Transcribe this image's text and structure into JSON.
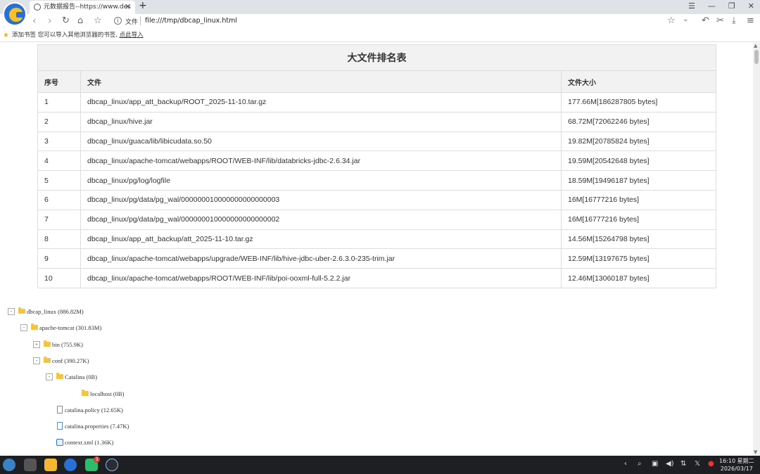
{
  "browser": {
    "tab_title": "元数据报告--https://www.des",
    "address_label": "文件",
    "url": "file:///tmp/dbcap_linux.html",
    "bookmark_bar_text": "添加书签  您可以导入其他浏览器的书签,",
    "bookmark_import_link": "点此导入"
  },
  "table": {
    "title": "大文件排名表",
    "headers": [
      "序号",
      "文件",
      "文件大小"
    ],
    "rows": [
      {
        "no": "1",
        "file": "dbcap_linux/app_att_backup/ROOT_2025-11-10.tar.gz",
        "size": "177.66M[186287805 bytes]"
      },
      {
        "no": "2",
        "file": "dbcap_linux/hive.jar",
        "size": "68.72M[72062246 bytes]"
      },
      {
        "no": "3",
        "file": "dbcap_linux/guaca/lib/libicudata.so.50",
        "size": "19.82M[20785824 bytes]"
      },
      {
        "no": "4",
        "file": "dbcap_linux/apache-tomcat/webapps/ROOT/WEB-INF/lib/databricks-jdbc-2.6.34.jar",
        "size": "19.59M[20542648 bytes]"
      },
      {
        "no": "5",
        "file": "dbcap_linux/pg/log/logfile",
        "size": "18.59M[19496187 bytes]"
      },
      {
        "no": "6",
        "file": "dbcap_linux/pg/data/pg_wal/000000010000000000000003",
        "size": "16M[16777216 bytes]"
      },
      {
        "no": "7",
        "file": "dbcap_linux/pg/data/pg_wal/000000010000000000000002",
        "size": "16M[16777216 bytes]"
      },
      {
        "no": "8",
        "file": "dbcap_linux/app_att_backup/att_2025-11-10.tar.gz",
        "size": "14.56M[15264798 bytes]"
      },
      {
        "no": "9",
        "file": "dbcap_linux/apache-tomcat/webapps/upgrade/WEB-INF/lib/hive-jdbc-uber-2.6.3.0-235-trim.jar",
        "size": "12.59M[13197675 bytes]"
      },
      {
        "no": "10",
        "file": "dbcap_linux/apache-tomcat/webapps/ROOT/WEB-INF/lib/poi-ooxml-full-5.2.2.jar",
        "size": "12.46M[13060187 bytes]"
      }
    ]
  },
  "tree": [
    {
      "label": "dbcap_linux (886.82M)",
      "type": "folder",
      "toggle": "-",
      "depth": 0
    },
    {
      "label": "apache-tomcat (301.83M)",
      "type": "folder",
      "toggle": "-",
      "depth": 1
    },
    {
      "label": "bin (755.9K)",
      "type": "folder",
      "toggle": "+",
      "depth": 2
    },
    {
      "label": "conf (390.27K)",
      "type": "folder",
      "toggle": "-",
      "depth": 2
    },
    {
      "label": "Catalina (0B)",
      "type": "folder",
      "toggle": "-",
      "depth": 3
    },
    {
      "label": "localhost (0B)",
      "type": "folder",
      "toggle": "",
      "depth": 4
    },
    {
      "label": "catalina.policy (12.65K)",
      "type": "file",
      "toggle": "",
      "depth": 3
    },
    {
      "label": "catalina.properties (7.47K)",
      "type": "properties",
      "toggle": "",
      "depth": 3
    },
    {
      "label": "context.xml (1.36K)",
      "type": "xml",
      "toggle": "",
      "depth": 3
    }
  ],
  "taskbar": {
    "time": "16:10 星期二",
    "date": "2026/03/17",
    "badge": "3"
  },
  "colors": {
    "accent": "#2a6fd6",
    "folder": "#f5c242",
    "header_bg": "#f2f2f2",
    "taskbar_bg": "#1e1f22"
  }
}
